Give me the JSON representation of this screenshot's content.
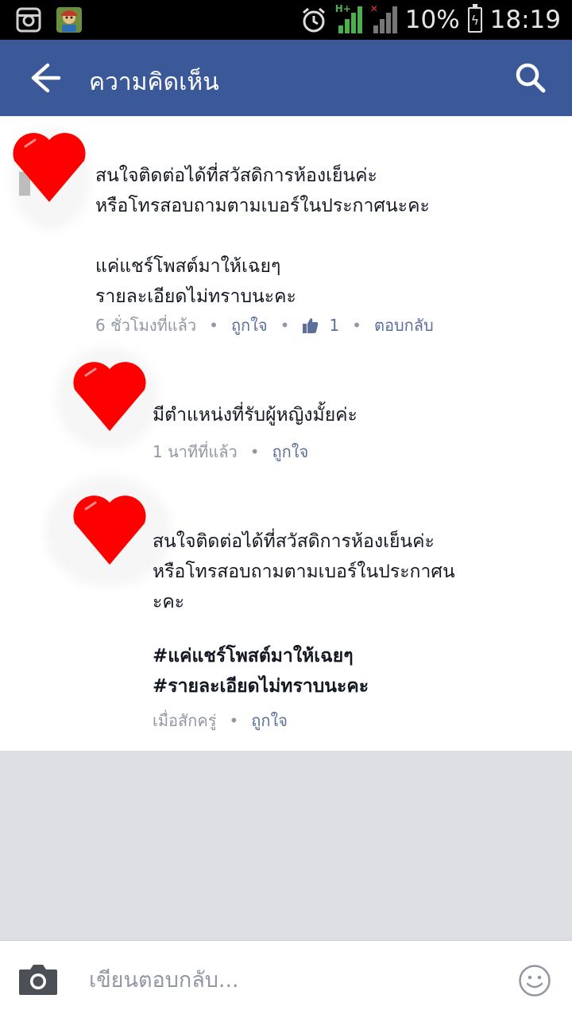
{
  "status_bar": {
    "network_tag": "H+",
    "battery": "10%",
    "time": "18:19"
  },
  "header": {
    "title": "ความคิดเห็น"
  },
  "comments": [
    {
      "text": "สนใจติดต่อได้ที่สวัสดิการห้องเย็นค่ะ\nหรือโทรสอบถามตามเบอร์ในประกาศนะคะ\n\nแค่แชร์โพสต์มาให้เฉยๆ\nรายละเอียดไม่ทราบนะคะ",
      "time": "6 ชั่วโมงที่แล้ว",
      "like_label": "ถูกใจ",
      "like_count": "1",
      "reply_label": "ตอบกลับ"
    },
    {
      "text": "มีตำแหน่งที่รับผู้หญิงมั้ยค่ะ",
      "time": "1 นาทีที่แล้ว",
      "like_label": "ถูกใจ"
    },
    {
      "text": "สนใจติดต่อได้ที่สวัสดิการห้องเย็นค่ะ\nหรือโทรสอบถามตามเบอร์ในประกาศน\nะคะ",
      "hashtags": "#แค่แชร์โพสต์มาให้เฉยๆ\n#รายละเอียดไม่ทราบนะคะ",
      "time": "เมื่อสักครู่",
      "like_label": "ถูกใจ"
    }
  ],
  "composer": {
    "placeholder": "เขียนตอบกลับ..."
  },
  "colors": {
    "header": "#3b5998",
    "heart": "#ff0000",
    "link": "#5b6f9a",
    "muted": "#9197a3",
    "grey_area": "#dddfe2"
  }
}
